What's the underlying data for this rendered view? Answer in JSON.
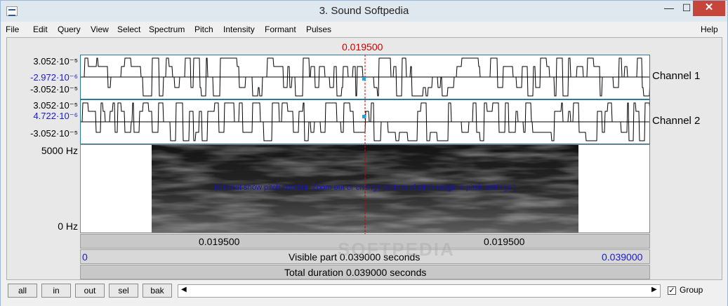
{
  "window": {
    "title": "3. Sound Softpedia",
    "min_glyph": "—",
    "max_glyph": "☐",
    "close_glyph": "✕"
  },
  "menu": {
    "items": [
      "File",
      "Edit",
      "Query",
      "View",
      "Select",
      "Spectrum",
      "Pitch",
      "Intensity",
      "Formant",
      "Pulses"
    ],
    "help": "Help"
  },
  "cursor": {
    "time": "0.019500"
  },
  "channel1": {
    "label": "Channel 1",
    "max": "3.052·10⁻⁵",
    "value": "-2.972·10⁻⁶",
    "min": "-3.052·10⁻⁵"
  },
  "channel2": {
    "label": "Channel 2",
    "max": "3.052·10⁻⁵",
    "value": "4.722·10⁻⁶",
    "min": "-3.052·10⁻⁵"
  },
  "spectrogram": {
    "top": "5000 Hz",
    "bottom": "0 Hz",
    "pitch_message": "(Cannot show pitch contour. Zoom out or change bottom of pitch range in pitch settings.)"
  },
  "selection_bar": {
    "left": "0.019500",
    "right": "0.019500"
  },
  "visible_bar": {
    "start": "0",
    "text": "Visible part 0.039000 seconds",
    "end": "0.039000"
  },
  "total_bar": {
    "text": "Total duration 0.039000 seconds"
  },
  "buttons": {
    "all": "all",
    "in": "in",
    "out": "out",
    "sel": "sel",
    "bak": "bak"
  },
  "group": {
    "label": "Group",
    "checked": true
  },
  "watermark": "SOFTPEDIA",
  "colors": {
    "cursor": "#d00000",
    "value_text": "#1a1ad0",
    "waveform_border": "#2a7a9a"
  }
}
